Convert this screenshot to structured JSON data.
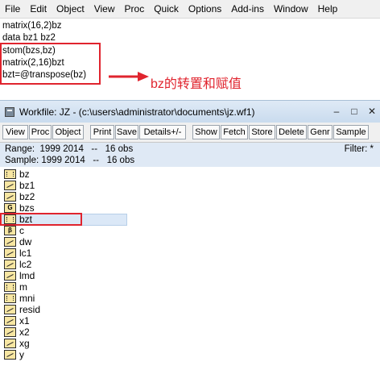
{
  "menu": [
    "File",
    "Edit",
    "Object",
    "View",
    "Proc",
    "Quick",
    "Options",
    "Add-ins",
    "Window",
    "Help"
  ],
  "commands": [
    "matrix(16,2)bz",
    "data bz1 bz2",
    "stom(bzs,bz)",
    "matrix(2,16)bzt",
    "bzt=@transpose(bz)"
  ],
  "annotation": "bz的转置和赋值",
  "workfile": {
    "title": "Workfile: JZ - (c:\\users\\administrator\\documents\\jz.wf1)",
    "buttons": [
      "View",
      "Proc",
      "Object",
      "Print",
      "Save",
      "Details+/-",
      "Show",
      "Fetch",
      "Store",
      "Delete",
      "Genr",
      "Sample"
    ],
    "range": "Range:  1999 2014   --   16 obs",
    "sample": "Sample: 1999 2014   --   16 obs",
    "filter": "Filter: *",
    "objects": [
      {
        "name": "bz",
        "icon": "matrix"
      },
      {
        "name": "bz1",
        "icon": "series"
      },
      {
        "name": "bz2",
        "icon": "series"
      },
      {
        "name": "bzs",
        "icon": "group",
        "glyph": "G"
      },
      {
        "name": "bzt",
        "icon": "matrix"
      },
      {
        "name": "c",
        "icon": "coef",
        "glyph": "β"
      },
      {
        "name": "dw",
        "icon": "series"
      },
      {
        "name": "lc1",
        "icon": "series"
      },
      {
        "name": "lc2",
        "icon": "series"
      },
      {
        "name": "lmd",
        "icon": "series"
      },
      {
        "name": "m",
        "icon": "matrix"
      },
      {
        "name": "mni",
        "icon": "matrix"
      },
      {
        "name": "resid",
        "icon": "series"
      },
      {
        "name": "x1",
        "icon": "series"
      },
      {
        "name": "x2",
        "icon": "series"
      },
      {
        "name": "xg",
        "icon": "series"
      },
      {
        "name": "y",
        "icon": "series"
      }
    ]
  },
  "colors": {
    "highlight": "#e0242e",
    "panel": "#dfe9f5"
  }
}
